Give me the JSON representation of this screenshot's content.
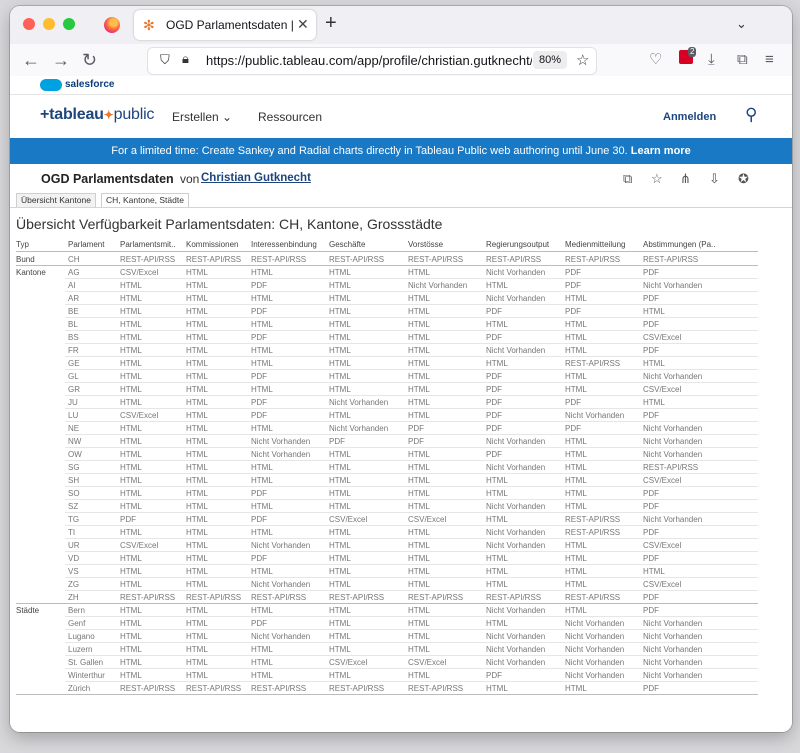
{
  "browser": {
    "tab_title": "OGD Parlamentsdaten | Tableau Public",
    "url": "https://public.tableau.com/app/profile/christian.gutknecht/viz/OGD",
    "zoom": "80%",
    "extension_badge": "2"
  },
  "salesforce": {
    "label": "salesforce"
  },
  "header": {
    "logo_main": "+tableau",
    "logo_star": "✦",
    "logo_sub": "public",
    "create": "Erstellen ⌄",
    "resources": "Ressourcen",
    "signin": "Anmelden"
  },
  "banner": {
    "text": "For a limited time: Create Sankey and Radial charts directly in Tableau Public web authoring until June 30.",
    "link": "Learn more"
  },
  "viz": {
    "title": "OGD Parlamentsdaten",
    "by": "von",
    "author": "Christian Gutknecht",
    "sheet_tabs": [
      "Übersicht Kantone",
      "CH, Kantone, Städte"
    ],
    "worksheet_title": "Übersicht Verfügbarkeit Parlamentsdaten: CH, Kantone, Grossstädte"
  },
  "table": {
    "columns": [
      "Typ",
      "Parlament",
      "Parlamentsmit..",
      "Kommissionen",
      "Interessenbindung",
      "Geschäfte",
      "Vorstösse",
      "Regierungsoutput",
      "Medienmitteilung",
      "Abstimmungen (Pa.."
    ],
    "groups": [
      {
        "name": "Bund",
        "rows": [
          [
            "CH",
            "REST-API/RSS",
            "REST-API/RSS",
            "REST-API/RSS",
            "REST-API/RSS",
            "REST-API/RSS",
            "REST-API/RSS",
            "REST-API/RSS",
            "REST-API/RSS"
          ]
        ]
      },
      {
        "name": "Kantone",
        "rows": [
          [
            "AG",
            "CSV/Excel",
            "HTML",
            "HTML",
            "HTML",
            "HTML",
            "Nicht Vorhanden",
            "PDF",
            "PDF"
          ],
          [
            "AI",
            "HTML",
            "HTML",
            "PDF",
            "HTML",
            "Nicht Vorhanden",
            "HTML",
            "PDF",
            "Nicht Vorhanden"
          ],
          [
            "AR",
            "HTML",
            "HTML",
            "HTML",
            "HTML",
            "HTML",
            "Nicht Vorhanden",
            "HTML",
            "PDF"
          ],
          [
            "BE",
            "HTML",
            "HTML",
            "PDF",
            "HTML",
            "HTML",
            "PDF",
            "PDF",
            "HTML"
          ],
          [
            "BL",
            "HTML",
            "HTML",
            "HTML",
            "HTML",
            "HTML",
            "HTML",
            "HTML",
            "PDF"
          ],
          [
            "BS",
            "HTML",
            "HTML",
            "PDF",
            "HTML",
            "HTML",
            "PDF",
            "HTML",
            "CSV/Excel"
          ],
          [
            "FR",
            "HTML",
            "HTML",
            "HTML",
            "HTML",
            "HTML",
            "Nicht Vorhanden",
            "HTML",
            "PDF"
          ],
          [
            "GE",
            "HTML",
            "HTML",
            "HTML",
            "HTML",
            "HTML",
            "HTML",
            "REST-API/RSS",
            "HTML"
          ],
          [
            "GL",
            "HTML",
            "HTML",
            "PDF",
            "HTML",
            "HTML",
            "PDF",
            "HTML",
            "Nicht Vorhanden"
          ],
          [
            "GR",
            "HTML",
            "HTML",
            "HTML",
            "HTML",
            "HTML",
            "PDF",
            "HTML",
            "CSV/Excel"
          ],
          [
            "JU",
            "HTML",
            "HTML",
            "PDF",
            "Nicht Vorhanden",
            "HTML",
            "PDF",
            "PDF",
            "HTML"
          ],
          [
            "LU",
            "CSV/Excel",
            "HTML",
            "PDF",
            "HTML",
            "HTML",
            "PDF",
            "Nicht Vorhanden",
            "PDF"
          ],
          [
            "NE",
            "HTML",
            "HTML",
            "HTML",
            "Nicht Vorhanden",
            "PDF",
            "PDF",
            "PDF",
            "Nicht Vorhanden"
          ],
          [
            "NW",
            "HTML",
            "HTML",
            "Nicht Vorhanden",
            "PDF",
            "PDF",
            "Nicht Vorhanden",
            "HTML",
            "Nicht Vorhanden"
          ],
          [
            "OW",
            "HTML",
            "HTML",
            "Nicht Vorhanden",
            "HTML",
            "HTML",
            "PDF",
            "HTML",
            "Nicht Vorhanden"
          ],
          [
            "SG",
            "HTML",
            "HTML",
            "HTML",
            "HTML",
            "HTML",
            "Nicht Vorhanden",
            "HTML",
            "REST-API/RSS"
          ],
          [
            "SH",
            "HTML",
            "HTML",
            "HTML",
            "HTML",
            "HTML",
            "HTML",
            "HTML",
            "CSV/Excel"
          ],
          [
            "SO",
            "HTML",
            "HTML",
            "PDF",
            "HTML",
            "HTML",
            "HTML",
            "HTML",
            "PDF"
          ],
          [
            "SZ",
            "HTML",
            "HTML",
            "HTML",
            "HTML",
            "HTML",
            "Nicht Vorhanden",
            "HTML",
            "PDF"
          ],
          [
            "TG",
            "PDF",
            "HTML",
            "PDF",
            "CSV/Excel",
            "CSV/Excel",
            "HTML",
            "REST-API/RSS",
            "Nicht Vorhanden"
          ],
          [
            "TI",
            "HTML",
            "HTML",
            "HTML",
            "HTML",
            "HTML",
            "Nicht Vorhanden",
            "REST-API/RSS",
            "PDF"
          ],
          [
            "UR",
            "CSV/Excel",
            "HTML",
            "Nicht Vorhanden",
            "HTML",
            "HTML",
            "Nicht Vorhanden",
            "HTML",
            "CSV/Excel"
          ],
          [
            "VD",
            "HTML",
            "HTML",
            "PDF",
            "HTML",
            "HTML",
            "HTML",
            "HTML",
            "PDF"
          ],
          [
            "VS",
            "HTML",
            "HTML",
            "HTML",
            "HTML",
            "HTML",
            "HTML",
            "HTML",
            "HTML"
          ],
          [
            "ZG",
            "HTML",
            "HTML",
            "Nicht Vorhanden",
            "HTML",
            "HTML",
            "HTML",
            "HTML",
            "CSV/Excel"
          ],
          [
            "ZH",
            "REST-API/RSS",
            "REST-API/RSS",
            "REST-API/RSS",
            "REST-API/RSS",
            "REST-API/RSS",
            "REST-API/RSS",
            "REST-API/RSS",
            "PDF"
          ]
        ]
      },
      {
        "name": "Städte",
        "rows": [
          [
            "Bern",
            "HTML",
            "HTML",
            "HTML",
            "HTML",
            "HTML",
            "Nicht Vorhanden",
            "HTML",
            "PDF"
          ],
          [
            "Genf",
            "HTML",
            "HTML",
            "PDF",
            "HTML",
            "HTML",
            "HTML",
            "Nicht Vorhanden",
            "Nicht Vorhanden"
          ],
          [
            "Lugano",
            "HTML",
            "HTML",
            "Nicht Vorhanden",
            "HTML",
            "HTML",
            "Nicht Vorhanden",
            "Nicht Vorhanden",
            "Nicht Vorhanden"
          ],
          [
            "Luzern",
            "HTML",
            "HTML",
            "HTML",
            "HTML",
            "HTML",
            "Nicht Vorhanden",
            "Nicht Vorhanden",
            "Nicht Vorhanden"
          ],
          [
            "St. Gallen",
            "HTML",
            "HTML",
            "HTML",
            "CSV/Excel",
            "CSV/Excel",
            "Nicht Vorhanden",
            "Nicht Vorhanden",
            "Nicht Vorhanden"
          ],
          [
            "Winterthur",
            "HTML",
            "HTML",
            "HTML",
            "HTML",
            "HTML",
            "PDF",
            "Nicht Vorhanden",
            "Nicht Vorhanden"
          ],
          [
            "Zürich",
            "REST-API/RSS",
            "REST-API/RSS",
            "REST-API/RSS",
            "REST-API/RSS",
            "REST-API/RSS",
            "HTML",
            "HTML",
            "PDF"
          ]
        ]
      }
    ]
  }
}
